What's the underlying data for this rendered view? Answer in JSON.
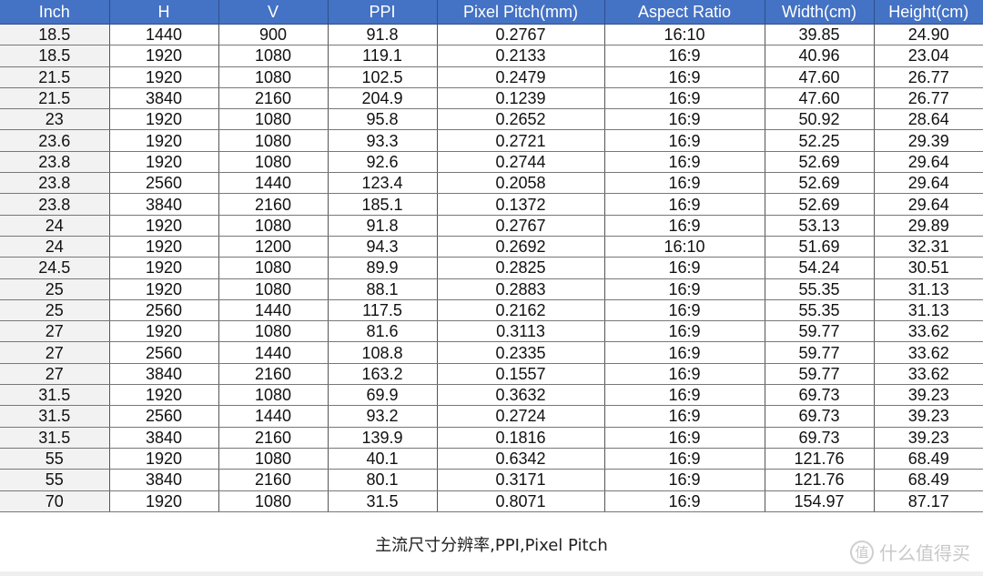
{
  "table": {
    "headers": [
      "Inch",
      "H",
      "V",
      "PPI",
      "Pixel Pitch(mm)",
      "Aspect Ratio",
      "Width(cm)",
      "Height(cm)"
    ],
    "rows": [
      [
        "18.5",
        "1440",
        "900",
        "91.8",
        "0.2767",
        "16:10",
        "39.85",
        "24.90"
      ],
      [
        "18.5",
        "1920",
        "1080",
        "119.1",
        "0.2133",
        "16:9",
        "40.96",
        "23.04"
      ],
      [
        "21.5",
        "1920",
        "1080",
        "102.5",
        "0.2479",
        "16:9",
        "47.60",
        "26.77"
      ],
      [
        "21.5",
        "3840",
        "2160",
        "204.9",
        "0.1239",
        "16:9",
        "47.60",
        "26.77"
      ],
      [
        "23",
        "1920",
        "1080",
        "95.8",
        "0.2652",
        "16:9",
        "50.92",
        "28.64"
      ],
      [
        "23.6",
        "1920",
        "1080",
        "93.3",
        "0.2721",
        "16:9",
        "52.25",
        "29.39"
      ],
      [
        "23.8",
        "1920",
        "1080",
        "92.6",
        "0.2744",
        "16:9",
        "52.69",
        "29.64"
      ],
      [
        "23.8",
        "2560",
        "1440",
        "123.4",
        "0.2058",
        "16:9",
        "52.69",
        "29.64"
      ],
      [
        "23.8",
        "3840",
        "2160",
        "185.1",
        "0.1372",
        "16:9",
        "52.69",
        "29.64"
      ],
      [
        "24",
        "1920",
        "1080",
        "91.8",
        "0.2767",
        "16:9",
        "53.13",
        "29.89"
      ],
      [
        "24",
        "1920",
        "1200",
        "94.3",
        "0.2692",
        "16:10",
        "51.69",
        "32.31"
      ],
      [
        "24.5",
        "1920",
        "1080",
        "89.9",
        "0.2825",
        "16:9",
        "54.24",
        "30.51"
      ],
      [
        "25",
        "1920",
        "1080",
        "88.1",
        "0.2883",
        "16:9",
        "55.35",
        "31.13"
      ],
      [
        "25",
        "2560",
        "1440",
        "117.5",
        "0.2162",
        "16:9",
        "55.35",
        "31.13"
      ],
      [
        "27",
        "1920",
        "1080",
        "81.6",
        "0.3113",
        "16:9",
        "59.77",
        "33.62"
      ],
      [
        "27",
        "2560",
        "1440",
        "108.8",
        "0.2335",
        "16:9",
        "59.77",
        "33.62"
      ],
      [
        "27",
        "3840",
        "2160",
        "163.2",
        "0.1557",
        "16:9",
        "59.77",
        "33.62"
      ],
      [
        "31.5",
        "1920",
        "1080",
        "69.9",
        "0.3632",
        "16:9",
        "69.73",
        "39.23"
      ],
      [
        "31.5",
        "2560",
        "1440",
        "93.2",
        "0.2724",
        "16:9",
        "69.73",
        "39.23"
      ],
      [
        "31.5",
        "3840",
        "2160",
        "139.9",
        "0.1816",
        "16:9",
        "69.73",
        "39.23"
      ],
      [
        "55",
        "1920",
        "1080",
        "40.1",
        "0.6342",
        "16:9",
        "121.76",
        "68.49"
      ],
      [
        "55",
        "3840",
        "2160",
        "80.1",
        "0.3171",
        "16:9",
        "121.76",
        "68.49"
      ],
      [
        "70",
        "1920",
        "1080",
        "31.5",
        "0.8071",
        "16:9",
        "154.97",
        "87.17"
      ]
    ]
  },
  "caption": "主流尺寸分辨率,PPI,Pixel Pitch",
  "watermark": {
    "logo_char": "值",
    "text": "什么值得买"
  },
  "colors": {
    "header_bg": "#4472c4",
    "header_text": "#ffffff",
    "first_col_bg": "#f2f2f2"
  }
}
